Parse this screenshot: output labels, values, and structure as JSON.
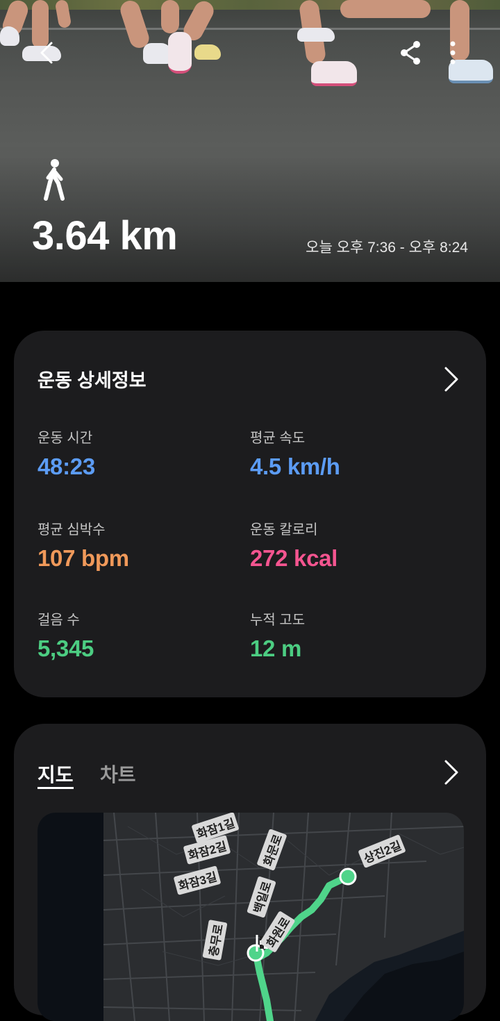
{
  "header": {
    "distance": "3.64 km",
    "time_range": "오늘 오후 7:36 - 오후 8:24",
    "icons": {
      "back": "back-arrow-icon",
      "share": "share-icon",
      "more": "more-vert-icon",
      "activity": "walking-icon"
    }
  },
  "details": {
    "title": "운동 상세정보",
    "stats": [
      {
        "label": "운동 시간",
        "value": "48:23",
        "color": "#5c9cf5"
      },
      {
        "label": "평균 속도",
        "value": "4.5 km/h",
        "color": "#5c9cf5"
      },
      {
        "label": "평균 심박수",
        "value": "107 bpm",
        "color": "#f0995a"
      },
      {
        "label": "운동 칼로리",
        "value": "272 kcal",
        "color": "#f45590"
      },
      {
        "label": "걸음 수",
        "value": "5,345",
        "color": "#4ccd82"
      },
      {
        "label": "누적 고도",
        "value": "12 m",
        "color": "#4ccd82"
      }
    ]
  },
  "map_section": {
    "tabs": [
      "지도",
      "차트"
    ],
    "active_tab": "지도",
    "route_color": "#4fd48a",
    "streets": [
      "화잠1길",
      "화잠2길",
      "화잠3길",
      "화문로",
      "충무로",
      "백일로",
      "상진2길",
      "화원로"
    ]
  }
}
